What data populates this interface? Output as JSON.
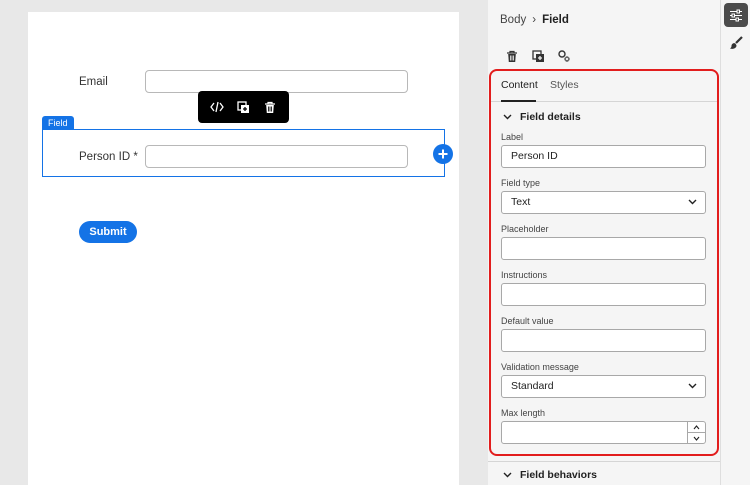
{
  "canvas": {
    "email_label": "Email",
    "selection_tag": "Field",
    "person_label": "Person ID",
    "required_marker": "*",
    "submit_label": "Submit",
    "toolbar_icons": [
      "code-icon",
      "duplicate-icon",
      "trash-icon"
    ]
  },
  "panel": {
    "breadcrumb": {
      "parent": "Body",
      "separator": "›",
      "current": "Field"
    },
    "tabs": [
      {
        "label": "Content",
        "active": true
      },
      {
        "label": "Styles",
        "active": false
      }
    ],
    "section_title": "Field details",
    "fields": {
      "label": {
        "label": "Label",
        "value": "Person ID"
      },
      "field_type": {
        "label": "Field type",
        "value": "Text"
      },
      "placeholder": {
        "label": "Placeholder",
        "value": ""
      },
      "instructions": {
        "label": "Instructions",
        "value": ""
      },
      "default_value": {
        "label": "Default value",
        "value": ""
      },
      "validation_message": {
        "label": "Validation message",
        "value": "Standard"
      },
      "max_length": {
        "label": "Max length",
        "value": ""
      }
    },
    "behaviors_title": "Field behaviors"
  },
  "colors": {
    "accent": "#1473e6",
    "highlight": "#e21d1d",
    "toolbar": "#000000",
    "rail_active": "#4b4b4b"
  }
}
